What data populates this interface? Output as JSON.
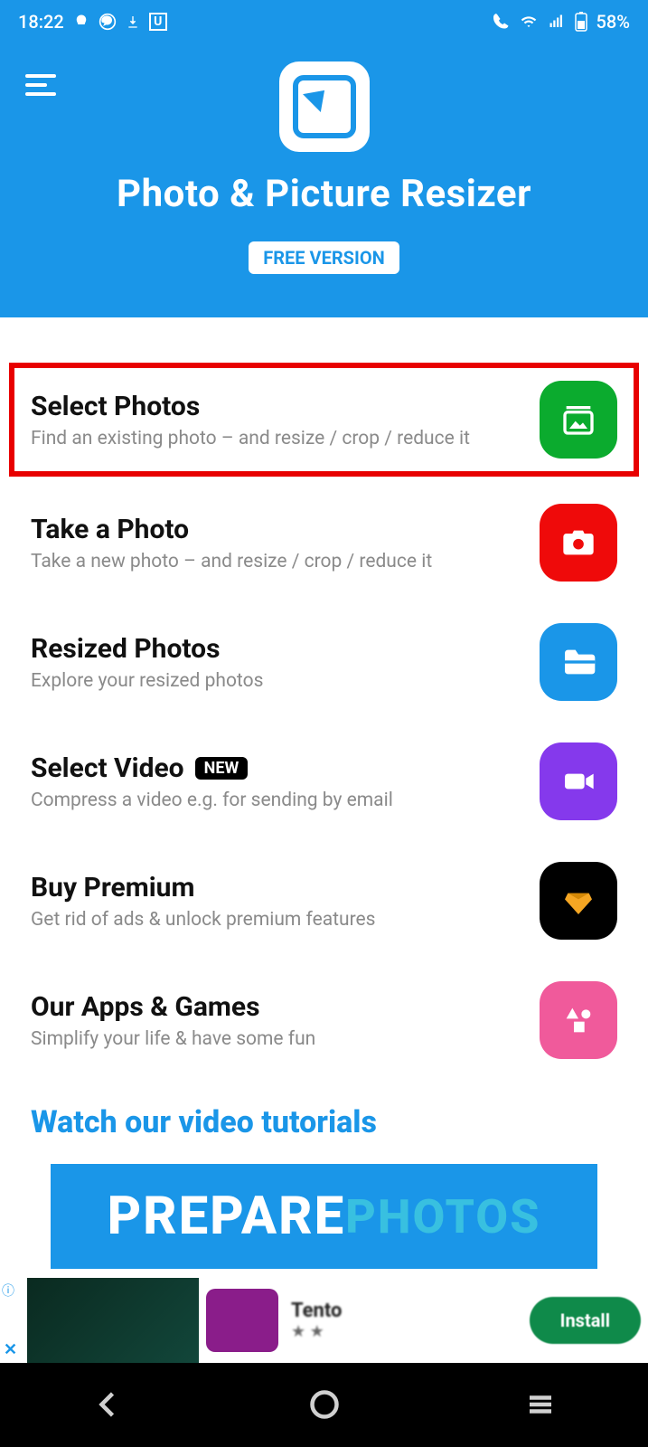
{
  "status": {
    "time": "18:22",
    "battery": "58%"
  },
  "header": {
    "title": "Photo & Picture Resizer",
    "badge": "FREE VERSION"
  },
  "menu": [
    {
      "title": "Select Photos",
      "desc": "Find an existing photo – and resize / crop / reduce it",
      "icon": "gallery",
      "color": "green",
      "highlight": true
    },
    {
      "title": "Take a Photo",
      "desc": "Take a new photo – and resize / crop / reduce it",
      "icon": "camera",
      "color": "red"
    },
    {
      "title": "Resized Photos",
      "desc": "Explore your resized photos",
      "icon": "folder",
      "color": "blue"
    },
    {
      "title": "Select Video",
      "desc": "Compress a video e.g. for sending by email",
      "icon": "video",
      "color": "purple",
      "tag": "NEW"
    },
    {
      "title": "Buy Premium",
      "desc": "Get rid of ads & unlock premium features",
      "icon": "diamond",
      "color": "black"
    },
    {
      "title": "Our Apps & Games",
      "desc": "Simplify your life & have some fun",
      "icon": "shapes",
      "color": "pink"
    }
  ],
  "tutorials": {
    "heading": "Watch our video tutorials",
    "thumb_text1": "PREPARE",
    "thumb_text2": "PHOTOS"
  },
  "ad": {
    "cta": "Install"
  }
}
